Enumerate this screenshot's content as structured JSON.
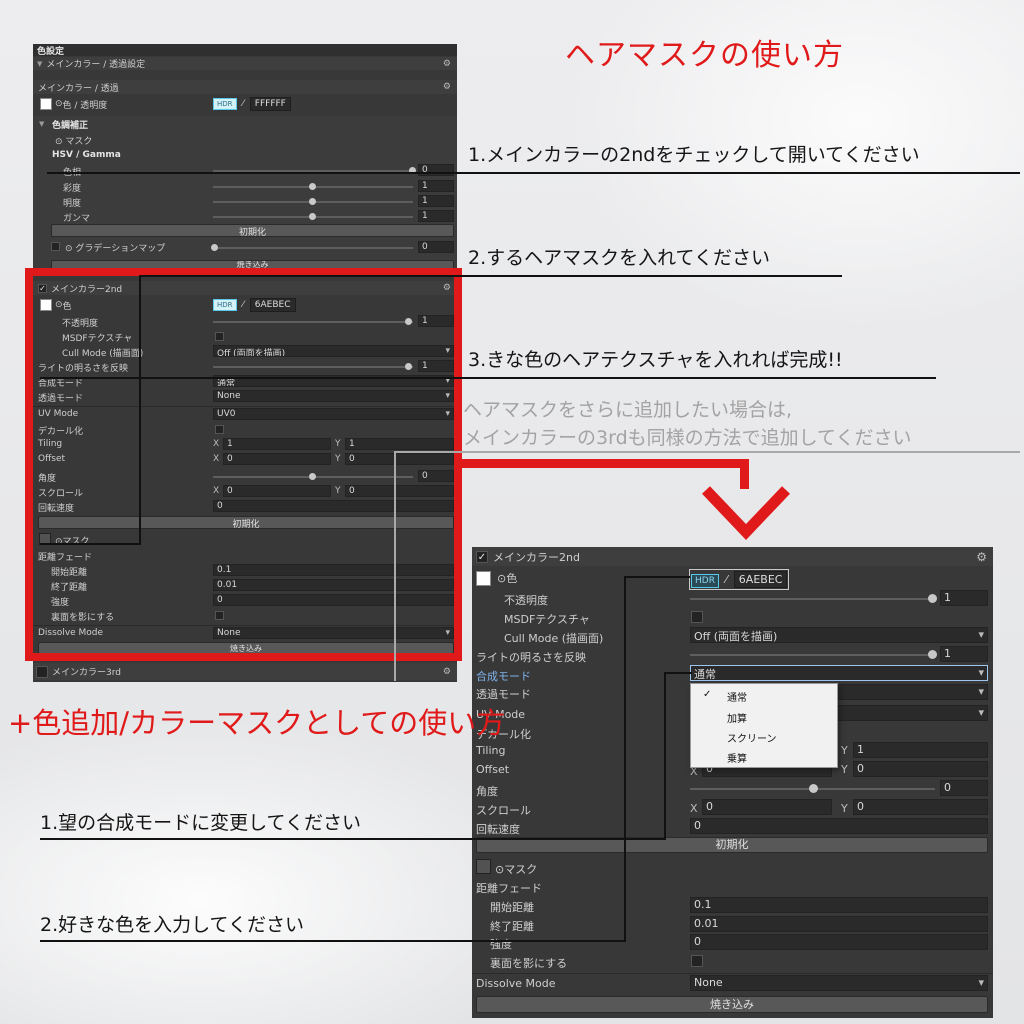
{
  "title": "ヘアマスクの使い方",
  "steps_top": [
    "1.メインカラーの2ndをチェックして開いてください",
    "2.するヘアマスクを入れてください",
    "3.きな色のヘアテクスチャを入れれば完成!!"
  ],
  "note_lines": [
    "ヘアマスクをさらに追加したい場合は,",
    "メインカラーの3rdも同様の方法で追加してください"
  ],
  "subtitle": "+色追加/カラーマスクとしての使い方",
  "steps_bottom": [
    "1.望の合成モードに変更してください",
    "2.好きな色を入力してください"
  ],
  "colors": {
    "accent_red": "#e01a1a",
    "panel_bg": "#383838",
    "hdr_cyan": "#5ac8e8"
  },
  "panel1": {
    "header": "色設定",
    "section": "メインカラー / 透過設定",
    "main_color": {
      "header": "メインカラー / 透過",
      "color_label": "色 / 透明度",
      "hdr": "HDR",
      "hex": "FFFFFF",
      "correction": "色調補正",
      "mask": "マスク",
      "hsv": "HSV / Gamma",
      "hue": "色相",
      "hue_value": "0",
      "saturation": "彩度",
      "saturation_value": "1",
      "brightness": "明度",
      "brightness_value": "1",
      "gamma": "ガンマ",
      "gamma_value": "1",
      "reset": "初期化",
      "gradient_map": "グラデーションマップ",
      "gradient_value": "0",
      "bake": "焼き込み"
    },
    "second": {
      "header": "メインカラー2nd",
      "color": "色",
      "hdr": "HDR",
      "hex": "6AEBEC",
      "opacity": "不透明度",
      "opacity_value": "1",
      "msdf": "MSDFテクスチャ",
      "cull": "Cull Mode (描画面)",
      "cull_value": "Off (両面を描画)",
      "light": "ライトの明るさを反映",
      "light_value": "1",
      "blend": "合成モード",
      "blend_value": "通常",
      "alpha": "透過モード",
      "alpha_value": "None",
      "uv": "UV Mode",
      "uv_value": "UV0",
      "decal": "デカール化",
      "tiling": "Tiling",
      "tiling_x": "1",
      "tiling_y": "1",
      "offset": "Offset",
      "offset_x": "0",
      "offset_y": "0",
      "angle": "角度",
      "angle_value": "0",
      "scroll": "スクロール",
      "scroll_x": "0",
      "scroll_y": "0",
      "rot_speed": "回転速度",
      "rot_value": "0",
      "reset": "初期化",
      "mask": "マスク",
      "dist_fade": "距離フェード",
      "start": "開始距離",
      "start_value": "0.1",
      "end": "終了距離",
      "end_value": "0.01",
      "strength": "強度",
      "strength_value": "0",
      "shadow": "裏面を影にする",
      "dissolve": "Dissolve Mode",
      "dissolve_value": "None",
      "bake": "焼き込み"
    },
    "third": "メインカラー3rd"
  },
  "panel2": {
    "header": "メインカラー2nd",
    "color": "色",
    "hdr": "HDR",
    "hex": "6AEBEC",
    "opacity": "不透明度",
    "opacity_value": "1",
    "msdf": "MSDFテクスチャ",
    "cull": "Cull Mode (描画面)",
    "cull_value": "Off (両面を描画)",
    "light": "ライトの明るさを反映",
    "light_value": "1",
    "blend": "合成モード",
    "blend_value": "通常",
    "alpha": "透過モード",
    "uv": "UV Mode",
    "decal": "デカール化",
    "tiling": "Tiling",
    "tiling_y": "1",
    "offset": "Offset",
    "offset_x": "0",
    "offset_y": "0",
    "angle": "角度",
    "angle_value": "0",
    "scroll": "スクロール",
    "scroll_x": "0",
    "scroll_y": "0",
    "rot_speed": "回転速度",
    "rot_value": "0",
    "reset": "初期化",
    "mask": "マスク",
    "dist_fade": "距離フェード",
    "start": "開始距離",
    "start_value": "0.1",
    "end": "終了距離",
    "end_value": "0.01",
    "strength": "強度",
    "strength_value": "0",
    "shadow": "裏面を影にする",
    "dissolve": "Dissolve Mode",
    "dissolve_value": "None",
    "bake": "焼き込み",
    "blend_options": [
      "通常",
      "加算",
      "スクリーン",
      "乗算"
    ],
    "selected_mark": "✓"
  }
}
